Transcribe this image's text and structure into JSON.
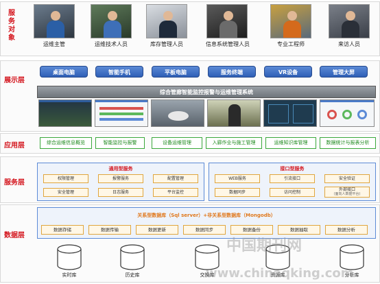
{
  "layers": {
    "service_objects": "服务对象",
    "display": "展示层",
    "application": "应用层",
    "service": "服务层",
    "data": "数据层"
  },
  "people": [
    "运维主管",
    "运维技术人员",
    "库存管理人员",
    "信息系统管理人员",
    "专业工程师",
    "来访人员"
  ],
  "devices": [
    "桌面电脑",
    "智能手机",
    "平板电脑",
    "服务终端",
    "VR设备",
    "管理大屏"
  ],
  "system_title": "综合管廊智能监控报警与运维管理系统",
  "applications": [
    "综合运维信息概览",
    "智能监控与报警",
    "设备运维管理",
    "入廊作业与施工管理",
    "运维知识库管理",
    "数据统计与报表分析"
  ],
  "general_services": {
    "title": "通用型服务",
    "items": [
      "权限管理",
      "报警服务",
      "配置管理",
      "安全管理",
      "日志服务",
      "平台监控"
    ]
  },
  "interface_services": {
    "title": "接口型服务",
    "items": [
      "WEB服务",
      "引流接口",
      "安全验证",
      "数据同步",
      "访问控制",
      "外部接口"
    ],
    "note": "(面向人数据平台)"
  },
  "database": {
    "title": "关系型数据库（Sql server）+非关系型数据库（Mongodb）",
    "operations": [
      "数据存储",
      "数据传输",
      "数据更新",
      "数据同步",
      "数据备份",
      "数据抽取",
      "数据分析"
    ],
    "stores": [
      "实时库",
      "历史库",
      "交换库",
      "资源库",
      "分析库"
    ]
  },
  "watermark": {
    "cn": "中国期刊网",
    "url": "www.chinaqking.com"
  },
  "colors": {
    "layer_label": "#d4141c",
    "device_pill": "#2e5fb6",
    "app_border": "#39a83a",
    "db_title": "#e0781c"
  }
}
